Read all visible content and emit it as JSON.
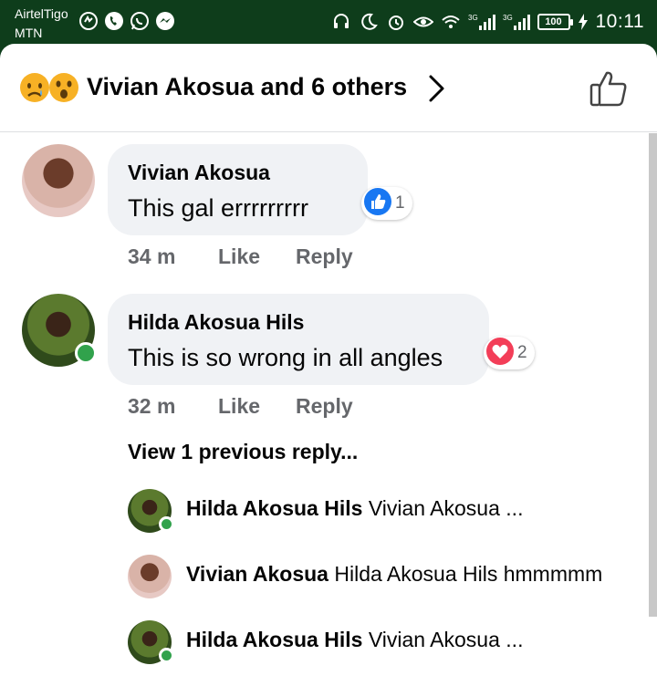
{
  "status_bar": {
    "carrier_1": "AirtelTigo",
    "carrier_2": "MTN",
    "battery": "100",
    "time": "10:11",
    "network_1": "3G",
    "network_2": "3G"
  },
  "header": {
    "reactors_text": "Vivian Akosua and 6 others",
    "reaction_icons": [
      "sad-face-icon",
      "wow-face-icon"
    ]
  },
  "comments": [
    {
      "author": "Vivian Akosua",
      "text": "This gal errrrrrrrr",
      "reaction_icon": "like-icon",
      "reaction_count": "1",
      "time": "34 m",
      "like_label": "Like",
      "reply_label": "Reply"
    },
    {
      "author": "Hilda Akosua Hils",
      "text": "This is so wrong in all angles",
      "reaction_icon": "love-icon",
      "reaction_count": "2",
      "time": "32 m",
      "like_label": "Like",
      "reply_label": "Reply"
    }
  ],
  "view_previous": "View 1 previous reply...",
  "replies": [
    {
      "author": "Hilda Akosua Hils",
      "text": "Vivian Akosua ..."
    },
    {
      "author": "Vivian Akosua",
      "text": "Hilda Akosua Hils hmmmmm"
    },
    {
      "author": "Hilda Akosua Hils",
      "text": "Vivian Akosua ..."
    }
  ],
  "colors": {
    "status_bar_bg": "#0e3d1b",
    "bubble_bg": "#f0f2f5",
    "like_blue": "#1877f2",
    "love_red": "#f33e58",
    "online_green": "#31a24c",
    "meta_gray": "#65676b"
  }
}
